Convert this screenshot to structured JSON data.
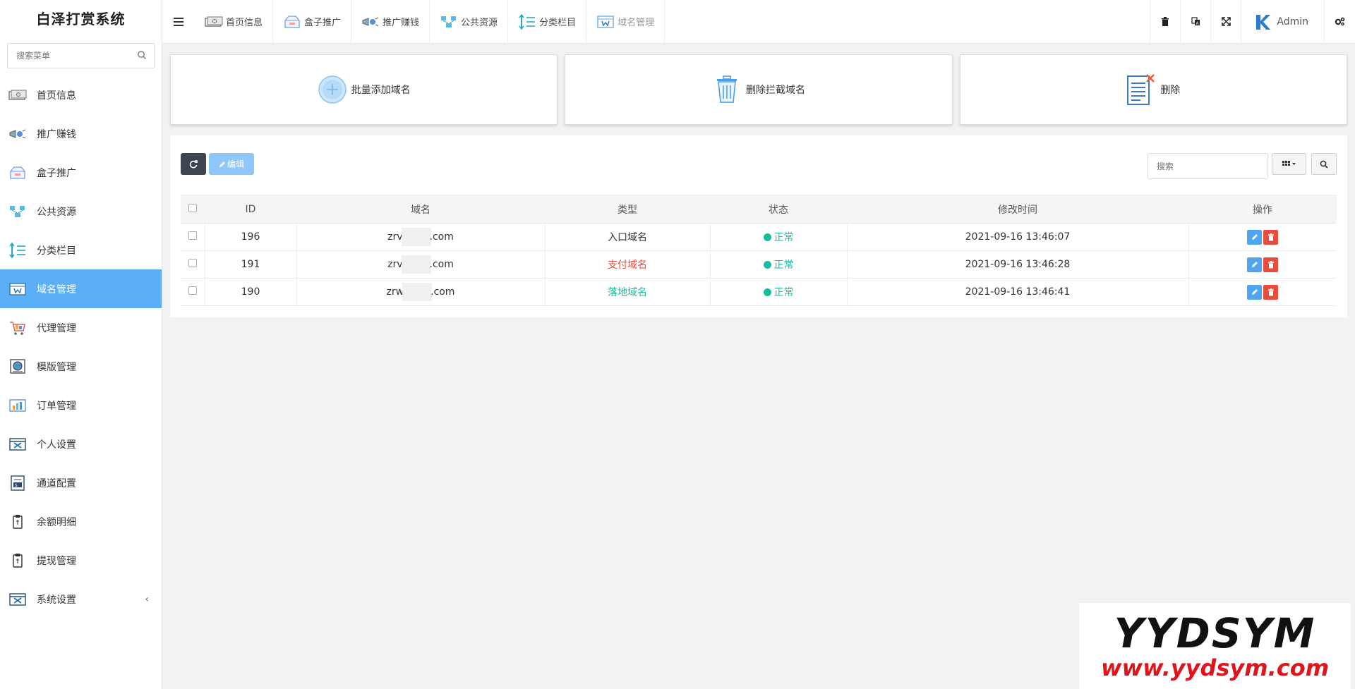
{
  "brand": "白泽打赏系统",
  "sidebar": {
    "search_placeholder": "搜索菜单",
    "items": [
      {
        "label": "首页信息",
        "icon": "banknote-icon"
      },
      {
        "label": "推广赚钱",
        "icon": "megaphone-icon"
      },
      {
        "label": "盒子推广",
        "icon": "box-icon"
      },
      {
        "label": "公共资源",
        "icon": "network-icon"
      },
      {
        "label": "分类栏目",
        "icon": "list-sort-icon"
      },
      {
        "label": "域名管理",
        "icon": "browser-w-icon",
        "active": true
      },
      {
        "label": "代理管理",
        "icon": "cart-icon"
      },
      {
        "label": "模版管理",
        "icon": "template-globe-icon"
      },
      {
        "label": "订单管理",
        "icon": "order-chart-icon"
      },
      {
        "label": "个人设置",
        "icon": "tools-icon"
      },
      {
        "label": "通道配置",
        "icon": "invoice-icon"
      },
      {
        "label": "余额明细",
        "icon": "clipboard-icon"
      },
      {
        "label": "提现管理",
        "icon": "clipboard-icon"
      },
      {
        "label": "系统设置",
        "icon": "tools-icon",
        "arrow": "‹"
      }
    ]
  },
  "topbar": {
    "tabs": [
      {
        "label": "首页信息",
        "icon": "banknote-icon"
      },
      {
        "label": "盒子推广",
        "icon": "box-icon"
      },
      {
        "label": "推广赚钱",
        "icon": "megaphone-icon"
      },
      {
        "label": "公共资源",
        "icon": "network-icon"
      },
      {
        "label": "分类栏目",
        "icon": "list-sort-icon"
      },
      {
        "label": "域名管理",
        "icon": "browser-w-icon"
      }
    ],
    "admin": "Admin"
  },
  "actions": [
    {
      "label": "批量添加域名",
      "icon": "add-circle-icon"
    },
    {
      "label": "删除拦截域名",
      "icon": "trash-can-icon"
    },
    {
      "label": "删除",
      "icon": "document-delete-icon"
    }
  ],
  "toolbar": {
    "edit_label": "编辑",
    "search_placeholder": "搜索"
  },
  "table": {
    "headers": [
      "ID",
      "域名",
      "类型",
      "状态",
      "修改时间",
      "操作"
    ],
    "rows": [
      {
        "id": "196",
        "domain_prefix": "zrv",
        "domain_suffix": ".com",
        "type": "入口域名",
        "type_color": "#333333",
        "status": "正常",
        "time": "2021-09-16 13:46:07"
      },
      {
        "id": "191",
        "domain_prefix": "zrv",
        "domain_suffix": ".com",
        "type": "支付域名",
        "type_color": "#e74c3c",
        "status": "正常",
        "time": "2021-09-16 13:46:28"
      },
      {
        "id": "190",
        "domain_prefix": "zrw",
        "domain_suffix": ".com",
        "type": "落地域名",
        "type_color": "#18bc9c",
        "status": "正常",
        "time": "2021-09-16 13:46:41"
      }
    ]
  },
  "watermark": {
    "logo": "YYDSYM",
    "url": "www.yydsym.com"
  },
  "colors": {
    "accent": "#5aaff5",
    "status_ok": "#18bc9c",
    "danger": "#e74c3c",
    "dark_button": "#3e4450"
  }
}
